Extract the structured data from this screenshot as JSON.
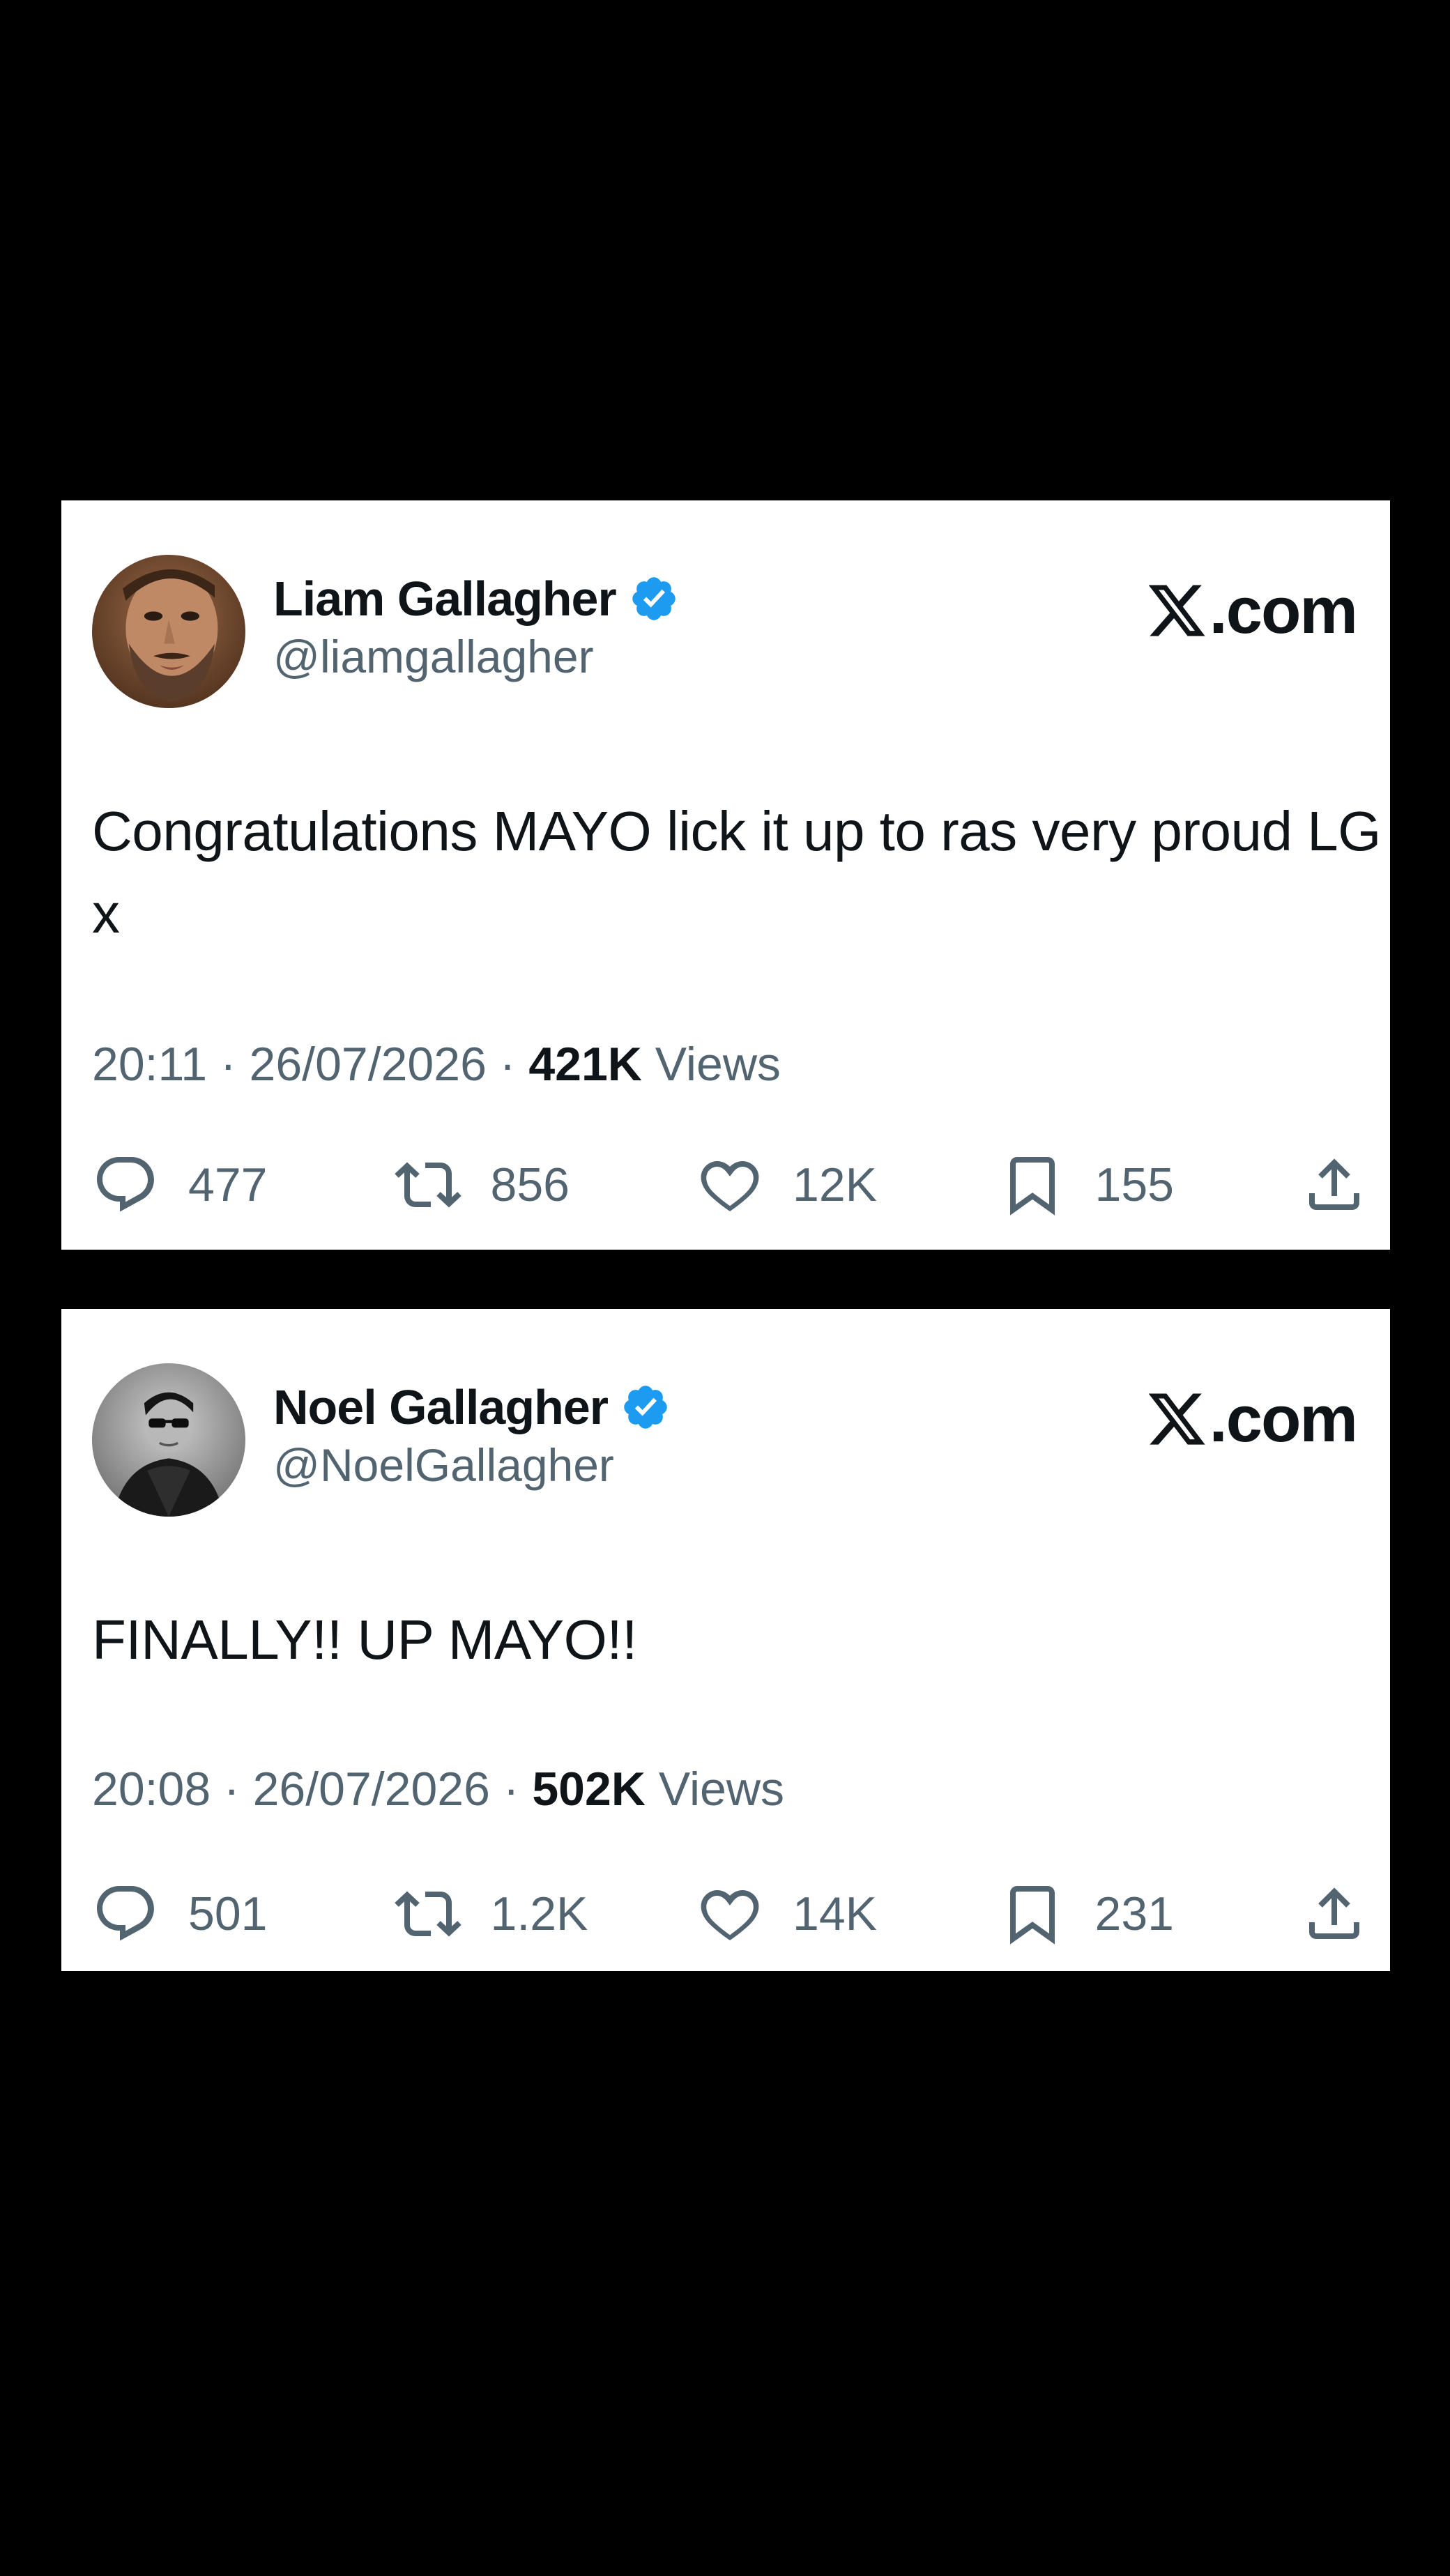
{
  "tweets": [
    {
      "name": "Liam Gallagher",
      "handle": "@liamgallagher",
      "site": ".com",
      "text": "Congratulations MAYO lick it up to ras very proud LG x",
      "time_date": "20:11 · 26/07/2026 · ",
      "views_count": "421K",
      "views_label": " Views",
      "replies": "477",
      "reposts": "856",
      "likes": "12K",
      "bookmarks": "155",
      "avatar": "bearded-man-avatar"
    },
    {
      "name": "Noel Gallagher",
      "handle": "@NoelGallagher",
      "site": ".com",
      "text": "FINALLY!! UP MAYO!!",
      "time_date": "20:08 · 26/07/2026 · ",
      "views_count": "502K",
      "views_label": " Views",
      "replies": "501",
      "reposts": "1.2K",
      "likes": "14K",
      "bookmarks": "231",
      "avatar": "man-in-sunglasses-bw-avatar"
    }
  ],
  "icons": {
    "verified": "verified-badge-icon",
    "logo": "x-logo-icon",
    "reply": "reply-bubble-icon",
    "repost": "repost-arrows-icon",
    "like": "heart-icon",
    "bookmark": "bookmark-icon",
    "share": "share-upload-icon"
  },
  "colors": {
    "background": "#000000",
    "card": "#ffffff",
    "text_primary": "#0f1419",
    "text_secondary": "#536471",
    "verified_blue": "#1d9bf0"
  }
}
